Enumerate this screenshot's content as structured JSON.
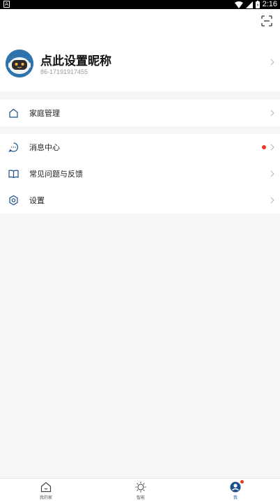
{
  "status_bar": {
    "time": "2:16",
    "left_icon": "A"
  },
  "profile": {
    "nickname": "点此设置昵称",
    "phone": "86-17191917455"
  },
  "menu_sections": [
    {
      "items": [
        {
          "label": "家庭管理",
          "icon": "home-icon"
        }
      ]
    },
    {
      "items": [
        {
          "label": "消息中心",
          "icon": "message-icon",
          "has_dot": true
        },
        {
          "label": "常见问题与反馈",
          "icon": "book-icon"
        },
        {
          "label": "设置",
          "icon": "settings-icon"
        }
      ]
    }
  ],
  "bottom_nav": {
    "tabs": [
      {
        "label": "我的家",
        "icon": "home-icon"
      },
      {
        "label": "智能",
        "icon": "sun-icon"
      },
      {
        "label": "我",
        "icon": "user-icon",
        "active": true,
        "badge": true
      }
    ]
  },
  "colors": {
    "accent": "#1a4f8a",
    "badge": "#ec3a1e",
    "background": "#f5f6f7"
  }
}
